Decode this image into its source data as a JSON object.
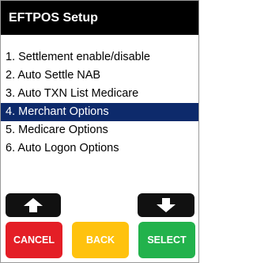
{
  "header": {
    "title": "EFTPOS Setup"
  },
  "menu": {
    "items": [
      {
        "label": "1. Settlement enable/disable"
      },
      {
        "label": "2. Auto Settle NAB"
      },
      {
        "label": "3. Auto TXN List Medicare"
      },
      {
        "label": "4. Merchant Options"
      },
      {
        "label": "5. Medicare Options"
      },
      {
        "label": "6. Auto Logon Options"
      }
    ],
    "selected_index": 3
  },
  "buttons": {
    "up_icon": "up-arrow-icon",
    "down_icon": "down-arrow-icon",
    "cancel_label": "CANCEL",
    "back_label": "BACK",
    "select_label": "SELECT"
  },
  "colors": {
    "header_bg": "#000000",
    "selected_bg": "#0d2a6b",
    "cancel": "#e41e26",
    "back": "#ffc20e",
    "select": "#22b24c",
    "arrow_button": "#111111"
  }
}
